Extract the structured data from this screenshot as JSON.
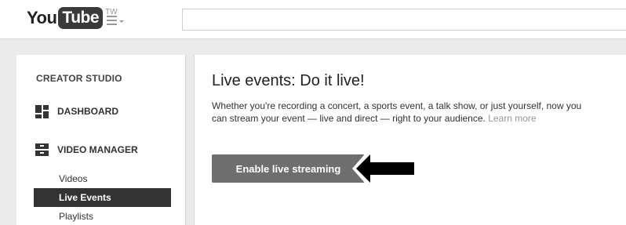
{
  "header": {
    "logo_you": "You",
    "logo_tube": "Tube",
    "region": "TW",
    "search_value": ""
  },
  "sidebar": {
    "title": "CREATOR STUDIO",
    "dashboard_label": "DASHBOARD",
    "video_manager_label": "VIDEO MANAGER",
    "sub_items": [
      "Videos",
      "Live Events",
      "Playlists"
    ],
    "active_item": "Live Events"
  },
  "main": {
    "heading": "Live events: Do it live!",
    "description": "Whether you're recording a concert, a sports event, a talk show, or just yourself, now you can stream your event — live and direct — right to your audience.",
    "learn_more": "Learn more",
    "enable_button": "Enable live streaming"
  },
  "colors": {
    "button_bg": "#6e6e6e",
    "active_nav_bg": "#333333",
    "page_bg": "#ebebeb",
    "annotation_arrow": "#000000"
  }
}
